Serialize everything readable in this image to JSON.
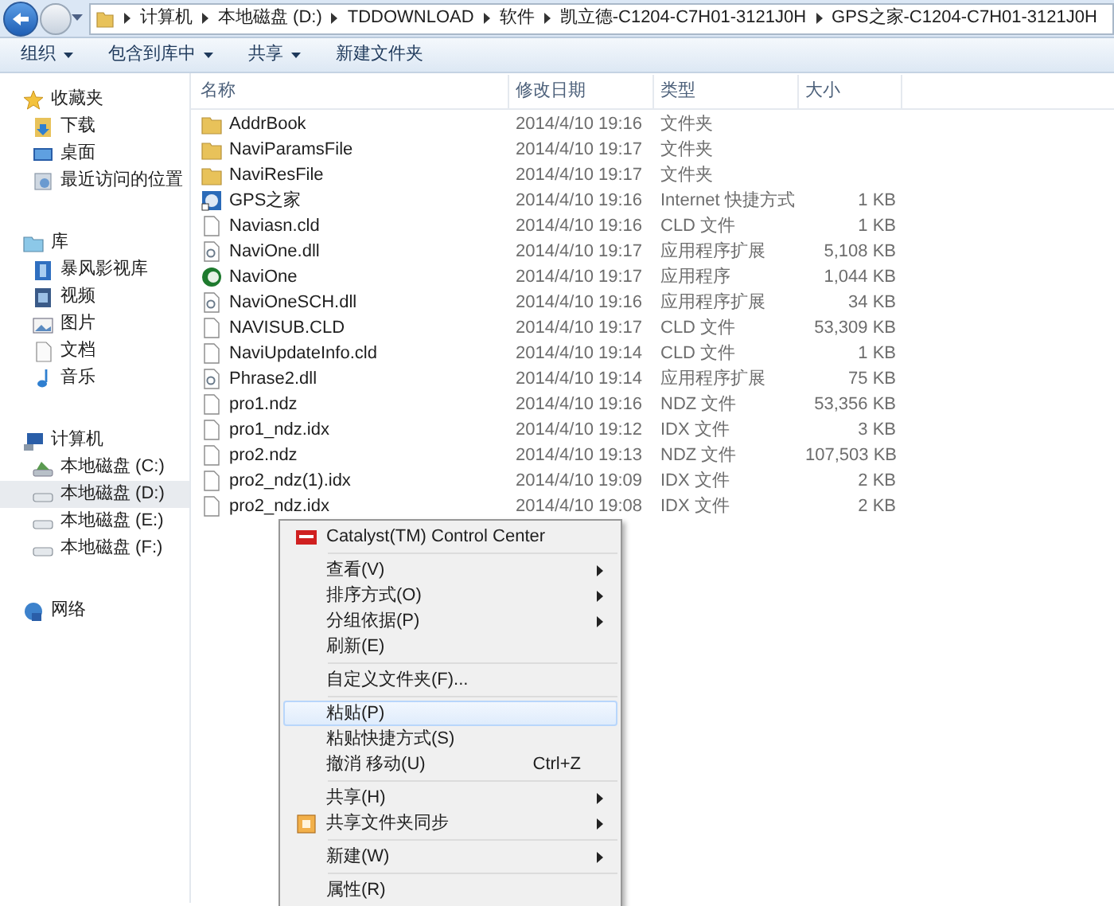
{
  "address_bar": {
    "path": [
      "计算机",
      "本地磁盘 (D:)",
      "TDDOWNLOAD",
      "软件",
      "凯立德-C1204-C7H01-3121J0H",
      "GPS之家-C1204-C7H01-3121J0H"
    ]
  },
  "toolbar": {
    "buttons": [
      {
        "label": "组织",
        "dropdown": true
      },
      {
        "label": "包含到库中",
        "dropdown": true
      },
      {
        "label": "共享",
        "dropdown": true
      },
      {
        "label": "新建文件夹",
        "dropdown": false
      }
    ]
  },
  "sidebar": {
    "groups": [
      {
        "label": "收藏夹",
        "items": [
          {
            "label": "下载",
            "selected": false
          },
          {
            "label": "桌面",
            "selected": false
          },
          {
            "label": "最近访问的位置",
            "selected": false
          }
        ]
      },
      {
        "label": "库",
        "items": [
          {
            "label": "暴风影视库",
            "selected": false
          },
          {
            "label": "视频",
            "selected": false
          },
          {
            "label": "图片",
            "selected": false
          },
          {
            "label": "文档",
            "selected": false
          },
          {
            "label": "音乐",
            "selected": false
          }
        ]
      },
      {
        "label": "计算机",
        "items": [
          {
            "label": "本地磁盘 (C:)",
            "selected": false
          },
          {
            "label": "本地磁盘 (D:)",
            "selected": true
          },
          {
            "label": "本地磁盘 (E:)",
            "selected": false
          },
          {
            "label": "本地磁盘 (F:)",
            "selected": false
          }
        ]
      },
      {
        "label": "网络"
      }
    ]
  },
  "table": {
    "columns": [
      "名称",
      "修改日期",
      "类型",
      "大小"
    ],
    "rows": [
      {
        "kind": "folder",
        "name": "AddrBook",
        "date": "2014/4/10 19:16",
        "type": "文件夹"
      },
      {
        "kind": "folder",
        "name": "NaviParamsFile",
        "date": "2014/4/10 19:17",
        "type": "文件夹"
      },
      {
        "kind": "folder",
        "name": "NaviResFile",
        "date": "2014/4/10 19:17",
        "type": "文件夹"
      },
      {
        "kind": "link",
        "name": "GPS之家",
        "date": "2014/4/10 19:16",
        "type": "Internet 快捷方式",
        "size": "1 KB"
      },
      {
        "kind": "file",
        "name": "Naviasn.cld",
        "date": "2014/4/10 19:16",
        "type": "CLD 文件",
        "size": "1 KB"
      },
      {
        "kind": "dll",
        "name": "NaviOne.dll",
        "date": "2014/4/10 19:17",
        "type": "应用程序扩展",
        "size": "5,108 KB"
      },
      {
        "kind": "app",
        "name": "NaviOne",
        "date": "2014/4/10 19:17",
        "type": "应用程序",
        "size": "1,044 KB"
      },
      {
        "kind": "dll",
        "name": "NaviOneSCH.dll",
        "date": "2014/4/10 19:16",
        "type": "应用程序扩展",
        "size": "34 KB"
      },
      {
        "kind": "file",
        "name": "NAVISUB.CLD",
        "date": "2014/4/10 19:17",
        "type": "CLD 文件",
        "size": "53,309 KB"
      },
      {
        "kind": "file",
        "name": "NaviUpdateInfo.cld",
        "date": "2014/4/10 19:14",
        "type": "CLD 文件",
        "size": "1 KB"
      },
      {
        "kind": "dll",
        "name": "Phrase2.dll",
        "date": "2014/4/10 19:14",
        "type": "应用程序扩展",
        "size": "75 KB"
      },
      {
        "kind": "file",
        "name": "pro1.ndz",
        "date": "2014/4/10 19:16",
        "type": "NDZ 文件",
        "size": "53,356 KB"
      },
      {
        "kind": "file",
        "name": "pro1_ndz.idx",
        "date": "2014/4/10 19:12",
        "type": "IDX 文件",
        "size": "3 KB"
      },
      {
        "kind": "file",
        "name": "pro2.ndz",
        "date": "2014/4/10 19:13",
        "type": "NDZ 文件",
        "size": "107,503 KB"
      },
      {
        "kind": "file",
        "name": "pro2_ndz(1).idx",
        "date": "2014/4/10 19:09",
        "type": "IDX 文件",
        "size": "2 KB"
      },
      {
        "kind": "file",
        "name": "pro2_ndz.idx",
        "date": "2014/4/10 19:08",
        "type": "IDX 文件",
        "size": "2 KB"
      }
    ]
  },
  "context_menu": {
    "items": [
      {
        "kind": "item",
        "label": "Catalyst(TM) Control Center",
        "submenu": false,
        "selected": false
      },
      {
        "kind": "separator"
      },
      {
        "kind": "item",
        "label": "查看(V)",
        "submenu": true,
        "selected": false
      },
      {
        "kind": "item",
        "label": "排序方式(O)",
        "submenu": true,
        "selected": false
      },
      {
        "kind": "item",
        "label": "分组依据(P)",
        "submenu": true,
        "selected": false
      },
      {
        "kind": "item",
        "label": "刷新(E)",
        "submenu": false,
        "selected": false
      },
      {
        "kind": "separator"
      },
      {
        "kind": "item",
        "label": "自定义文件夹(F)...",
        "submenu": false,
        "selected": false
      },
      {
        "kind": "separator"
      },
      {
        "kind": "item",
        "label": "粘贴(P)",
        "submenu": false,
        "selected": true
      },
      {
        "kind": "item",
        "label": "粘贴快捷方式(S)",
        "submenu": false,
        "selected": false
      },
      {
        "kind": "item",
        "label": "撤消 移动(U)",
        "shortcut": "Ctrl+Z",
        "submenu": false,
        "selected": false
      },
      {
        "kind": "separator"
      },
      {
        "kind": "item",
        "label": "共享(H)",
        "submenu": true,
        "selected": false
      },
      {
        "kind": "item",
        "label": "共享文件夹同步",
        "submenu": true,
        "selected": false
      },
      {
        "kind": "separator"
      },
      {
        "kind": "item",
        "label": "新建(W)",
        "submenu": true,
        "selected": false
      },
      {
        "kind": "separator"
      },
      {
        "kind": "item",
        "label": "属性(R)",
        "submenu": false,
        "selected": false
      }
    ]
  }
}
